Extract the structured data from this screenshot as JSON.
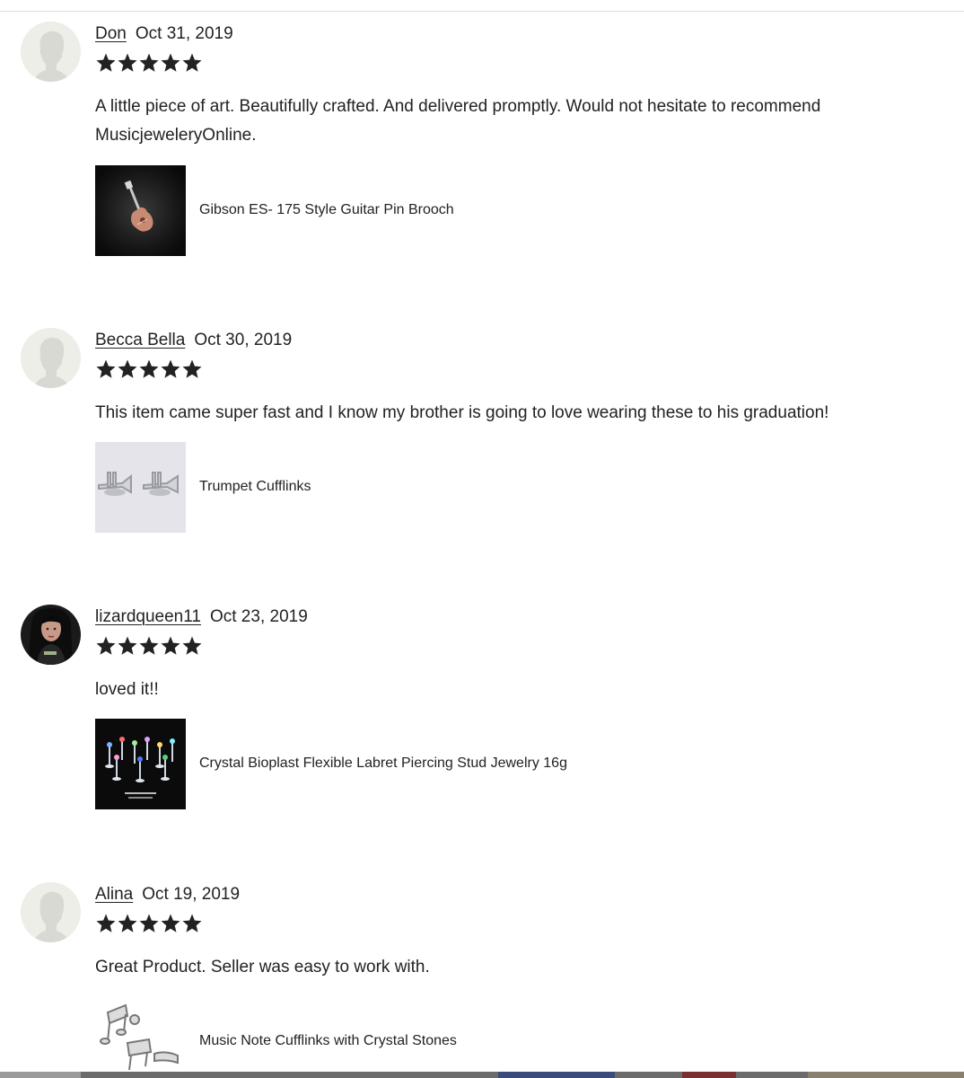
{
  "reviews": [
    {
      "reviewer": "Don",
      "date": "Oct 31, 2019",
      "rating": 5,
      "text": "A little piece of art. Beautifully crafted. And delivered promptly. Would not hesitate to recommend MusicjeweleryOnline.",
      "item": {
        "title": "Gibson ES- 175 Style Guitar Pin Brooch",
        "thumb_icon": "guitar-brooch-thumbnail"
      },
      "avatar": "default-avatar-icon"
    },
    {
      "reviewer": "Becca Bella",
      "date": "Oct 30, 2019",
      "rating": 5,
      "text": "This item came super fast and I know my brother is going to love wearing these to his graduation!",
      "item": {
        "title": "Trumpet Cufflinks",
        "thumb_icon": "trumpet-cufflinks-thumbnail"
      },
      "avatar": "default-avatar-icon"
    },
    {
      "reviewer": "lizardqueen11",
      "date": "Oct 23, 2019",
      "rating": 5,
      "text": "loved it!!",
      "item": {
        "title": "Crystal Bioplast Flexible Labret Piercing Stud Jewelry 16g",
        "thumb_icon": "labret-studs-thumbnail"
      },
      "avatar": "user-photo-avatar"
    },
    {
      "reviewer": "Alina",
      "date": "Oct 19, 2019",
      "rating": 5,
      "text": "Great Product. Seller was easy to work with.",
      "item": {
        "title": "Music Note Cufflinks with Crystal Stones",
        "thumb_icon": "music-note-cufflinks-thumbnail"
      },
      "avatar": "default-avatar-icon"
    }
  ],
  "colors": {
    "text": "#222222",
    "star": "#222222",
    "avatar_bg": "#eeeee9",
    "avatar_silhouette": "#d8d8d3"
  }
}
